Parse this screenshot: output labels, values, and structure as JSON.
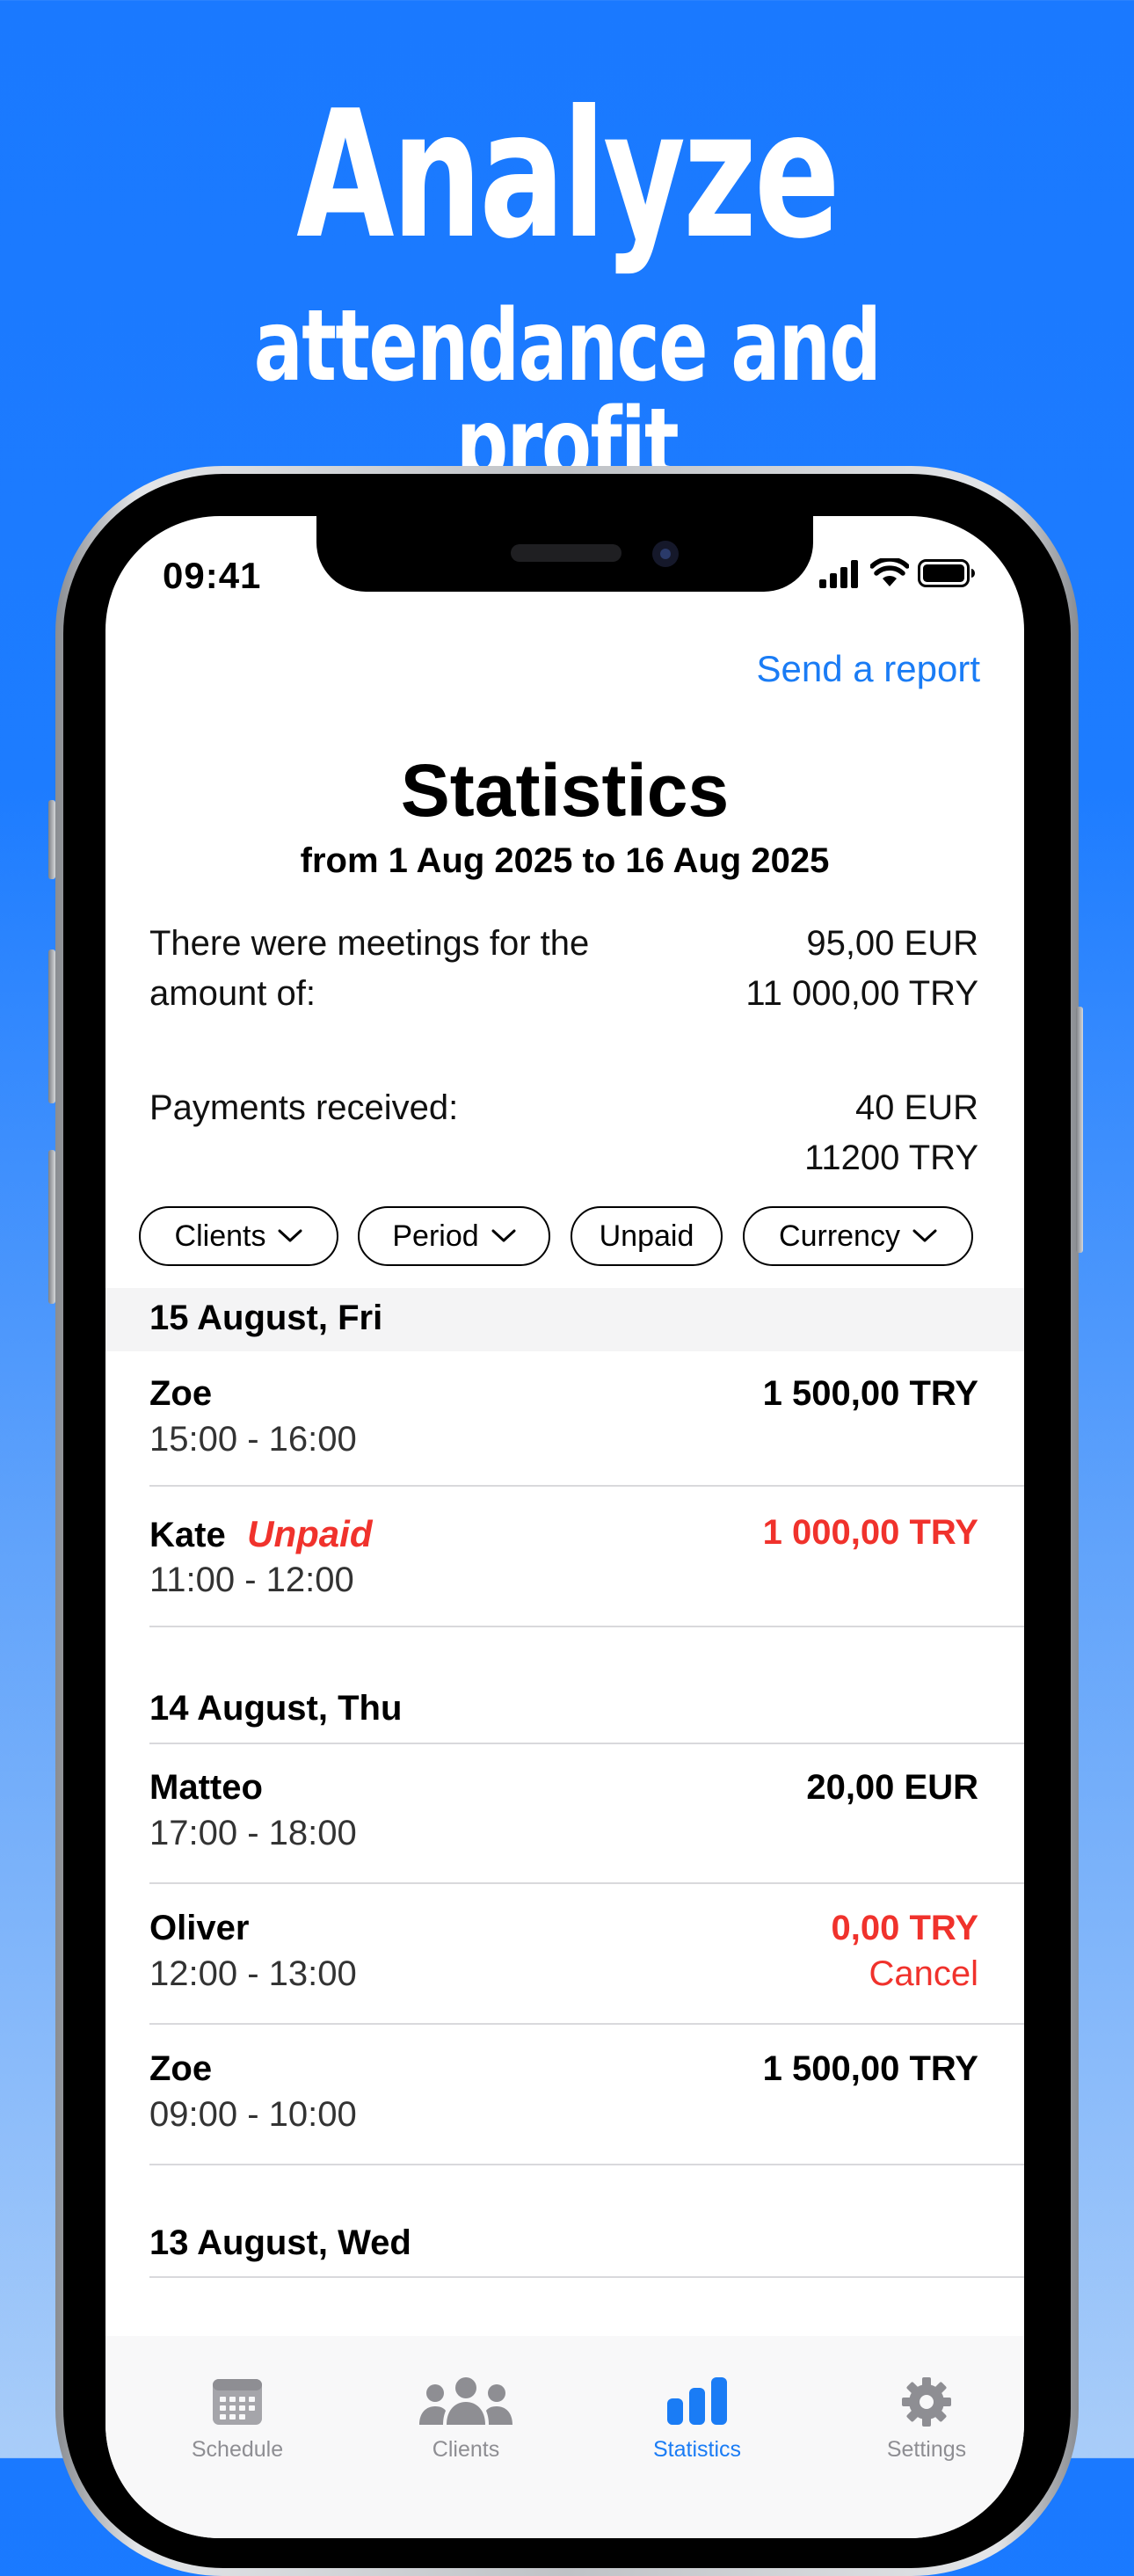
{
  "headline": {
    "title": "Analyze",
    "subtitle": "attendance and profit"
  },
  "status_bar": {
    "time": "09:41"
  },
  "header": {
    "send_report": "Send a report",
    "title": "Statistics",
    "range": "from 1 Aug 2025 to 16 Aug 2025"
  },
  "summary": {
    "meetings_label": "There were meetings for the amount of:",
    "meetings_line1": "There were meetings for the",
    "meetings_line2": "amount of:",
    "meetings_eur": "95,00 EUR",
    "meetings_try": "11 000,00 TRY",
    "payments_label": "Payments received:",
    "payments_eur": "40 EUR",
    "payments_try": "11200 TRY"
  },
  "filters": {
    "clients": "Clients",
    "period": "Period",
    "unpaid": "Unpaid",
    "currency": "Currency"
  },
  "sections": [
    {
      "title": "15 August, Fri",
      "items": [
        {
          "name": "Zoe",
          "time": "15:00 - 16:00",
          "amount": "1 500,00 TRY"
        },
        {
          "name": "Kate",
          "badge": "Unpaid",
          "time": "11:00 - 12:00",
          "amount": "1 000,00 TRY"
        }
      ]
    },
    {
      "title": "14 August, Thu",
      "items": [
        {
          "name": "Matteo",
          "time": "17:00 - 18:00",
          "amount": "20,00 EUR"
        },
        {
          "name": "Oliver",
          "time": "12:00 - 13:00",
          "amount": "0,00 TRY",
          "status": "Cancel"
        },
        {
          "name": "Zoe",
          "time": "09:00 - 10:00",
          "amount": "1 500,00 TRY"
        }
      ]
    },
    {
      "title": "13 August, Wed",
      "items": []
    }
  ],
  "tabbar": {
    "schedule": "Schedule",
    "clients": "Clients",
    "statistics": "Statistics",
    "settings": "Settings",
    "active": "statistics"
  },
  "colors": {
    "accent": "#1a7cf5",
    "danger": "#f0322c",
    "background": "#1a79ff"
  },
  "icons": [
    "signal-icon",
    "wifi-icon",
    "battery-icon",
    "chevron-down-icon",
    "calendar-icon",
    "people-icon",
    "bar-chart-icon",
    "gear-icon"
  ]
}
